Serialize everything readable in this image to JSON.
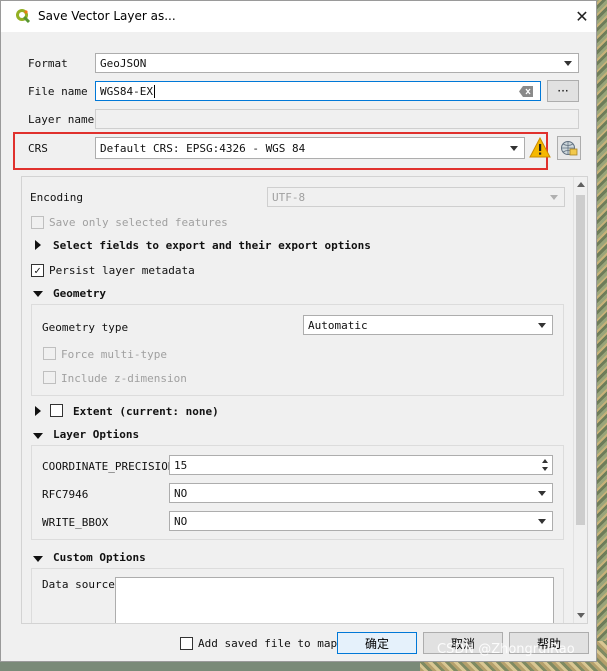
{
  "window": {
    "title": "Save Vector Layer as...",
    "close_symbol": "✕"
  },
  "colors": {
    "highlight": "#e0312d",
    "accent": "#0078d7",
    "warning": "#f5b800"
  },
  "form": {
    "format": {
      "label": "Format",
      "value": "GeoJSON"
    },
    "file_name": {
      "label": "File name",
      "value": "WGS84-EX",
      "browse_label": "···"
    },
    "layer_name": {
      "label": "Layer name",
      "value": ""
    },
    "crs": {
      "label": "CRS",
      "value": "Default CRS: EPSG:4326 - WGS 84",
      "warning_symbol": "!"
    }
  },
  "options": {
    "encoding": {
      "label": "Encoding",
      "value": "UTF-8"
    },
    "save_only_selected": {
      "label": "Save only selected features",
      "checked": false
    },
    "select_fields": {
      "label": "Select fields to export and their export options",
      "expanded": false
    },
    "persist_metadata": {
      "label": "Persist layer metadata",
      "checked": true,
      "check_mark": "✓"
    },
    "geometry": {
      "header": "Geometry",
      "type_label": "Geometry type",
      "type_value": "Automatic",
      "force_multi": "Force multi-type",
      "include_z": "Include z-dimension"
    },
    "extent": {
      "label": "Extent (current: none)",
      "expanded": false
    },
    "layer_options": {
      "header": "Layer Options",
      "rows": [
        {
          "label": "COORDINATE_PRECISION",
          "value": "15"
        },
        {
          "label": "RFC7946",
          "value": "NO"
        },
        {
          "label": "WRITE_BBOX",
          "value": "NO"
        }
      ]
    },
    "custom_options": {
      "header": "Custom Options",
      "data_source_label": "Data source"
    }
  },
  "footer": {
    "add_to_map": "Add saved file to map",
    "ok": "确定",
    "cancel": "取消",
    "help": "帮助"
  },
  "watermark": "CSDN @ZhongruiRao"
}
